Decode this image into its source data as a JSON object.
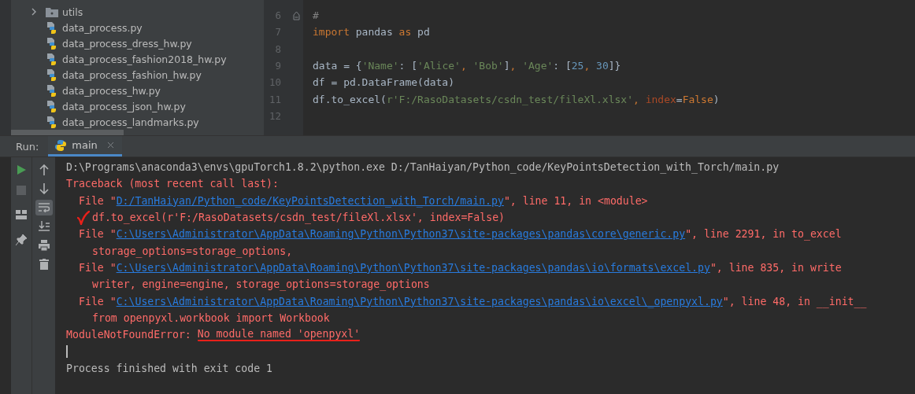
{
  "project_tree": {
    "items": [
      {
        "name": "utils",
        "kind": "folder",
        "expanded": false
      },
      {
        "name": "data_process.py",
        "kind": "python"
      },
      {
        "name": "data_process_dress_hw.py",
        "kind": "python"
      },
      {
        "name": "data_process_fashion2018_hw.py",
        "kind": "python"
      },
      {
        "name": "data_process_fashion_hw.py",
        "kind": "python"
      },
      {
        "name": "data_process_hw.py",
        "kind": "python"
      },
      {
        "name": "data_process_json_hw.py",
        "kind": "python"
      },
      {
        "name": "data_process_landmarks.py",
        "kind": "python"
      }
    ]
  },
  "editor": {
    "lines": [
      {
        "number": "6",
        "fold": true,
        "tokens": [
          {
            "kind": "comment",
            "text": "#"
          }
        ]
      },
      {
        "number": "7",
        "fold": false,
        "tokens": [
          {
            "kind": "kw",
            "text": "import"
          },
          {
            "kind": "plain",
            "text": " pandas "
          },
          {
            "kind": "kw",
            "text": "as"
          },
          {
            "kind": "plain",
            "text": " pd"
          }
        ]
      },
      {
        "number": "8",
        "fold": false
      },
      {
        "number": "9",
        "fold": false,
        "tokens": [
          {
            "kind": "plain",
            "text": "data = {"
          },
          {
            "kind": "str",
            "text": "'Name'"
          },
          {
            "kind": "plain",
            "text": ": ["
          },
          {
            "kind": "str",
            "text": "'Alice'"
          },
          {
            "kind": "kw",
            "text": ", "
          },
          {
            "kind": "str",
            "text": "'Bob'"
          },
          {
            "kind": "plain",
            "text": "]"
          },
          {
            "kind": "kw",
            "text": ", "
          },
          {
            "kind": "str",
            "text": "'Age'"
          },
          {
            "kind": "plain",
            "text": ": ["
          },
          {
            "kind": "num",
            "text": "25"
          },
          {
            "kind": "kw",
            "text": ", "
          },
          {
            "kind": "num",
            "text": "30"
          },
          {
            "kind": "plain",
            "text": "]}"
          }
        ]
      },
      {
        "number": "10",
        "fold": false,
        "tokens": [
          {
            "kind": "plain",
            "text": "df = pd.DataFrame(data)"
          }
        ]
      },
      {
        "number": "11",
        "fold": false,
        "tokens": [
          {
            "kind": "plain",
            "text": "df.to_excel("
          },
          {
            "kind": "str",
            "text": "r'F:/RasoDatasets/csdn_test/fileXl.xlsx'"
          },
          {
            "kind": "kw",
            "text": ", "
          },
          {
            "kind": "param",
            "text": "index"
          },
          {
            "kind": "plain",
            "text": "="
          },
          {
            "kind": "kw",
            "text": "False"
          },
          {
            "kind": "plain",
            "text": ")"
          }
        ]
      },
      {
        "number": "12",
        "fold": false
      }
    ]
  },
  "run_panel": {
    "label": "Run:",
    "tabs": [
      {
        "label": "main",
        "selected": true
      }
    ],
    "soft_wrap_on": true,
    "console": [
      {
        "kind": "cmd",
        "segments": [
          {
            "kind": "normal",
            "text": "D:\\Programs\\anaconda3\\envs\\gpuTorch1.8.2\\python.exe D:/TanHaiyan/Python_code/KeyPointsDetection_with_Torch/main.py"
          }
        ]
      },
      {
        "kind": "plain",
        "segments": [
          {
            "kind": "error",
            "text": "Traceback (most recent call last):"
          }
        ]
      },
      {
        "kind": "frame",
        "segments": [
          {
            "kind": "error",
            "text": "File \""
          },
          {
            "kind": "link",
            "text": "D:/TanHaiyan/Python_code/KeyPointsDetection_with_Torch/main.py"
          },
          {
            "kind": "error",
            "text": "\", line 11, in <module>"
          }
        ]
      },
      {
        "kind": "source",
        "ticked": true,
        "segments": [
          {
            "kind": "error",
            "text": "df.to_excel(r'F:/RasoDatasets/csdn_test/fileXl.xlsx', index=False)"
          }
        ]
      },
      {
        "kind": "frame",
        "segments": [
          {
            "kind": "error",
            "text": "File \""
          },
          {
            "kind": "link",
            "text": "C:\\Users\\Administrator\\AppData\\Roaming\\Python\\Python37\\site-packages\\pandas\\core\\generic.py"
          },
          {
            "kind": "error",
            "text": "\", line 2291, in to_excel"
          }
        ]
      },
      {
        "kind": "source",
        "segments": [
          {
            "kind": "error",
            "text": "storage_options=storage_options,"
          }
        ]
      },
      {
        "kind": "frame",
        "segments": [
          {
            "kind": "error",
            "text": "File \""
          },
          {
            "kind": "link",
            "text": "C:\\Users\\Administrator\\AppData\\Roaming\\Python\\Python37\\site-packages\\pandas\\io\\formats\\excel.py"
          },
          {
            "kind": "error",
            "text": "\", line 835, in write"
          }
        ]
      },
      {
        "kind": "source",
        "segments": [
          {
            "kind": "error",
            "text": "writer, engine=engine, storage_options=storage_options"
          }
        ]
      },
      {
        "kind": "frame",
        "segments": [
          {
            "kind": "error",
            "text": "File \""
          },
          {
            "kind": "link",
            "text": "C:\\Users\\Administrator\\AppData\\Roaming\\Python\\Python37\\site-packages\\pandas\\io\\excel\\_openpyxl.py"
          },
          {
            "kind": "error",
            "text": "\", line 48, in __init__"
          }
        ]
      },
      {
        "kind": "source",
        "segments": [
          {
            "kind": "error",
            "text": "from openpyxl.workbook import Workbook"
          }
        ]
      },
      {
        "kind": "plain",
        "segments": [
          {
            "kind": "error",
            "text": "ModuleNotFoundError: "
          },
          {
            "kind": "error",
            "text": "No module named 'openpyxl'",
            "marked": true
          }
        ]
      },
      {
        "kind": "caret"
      },
      {
        "kind": "plain",
        "segments": [
          {
            "kind": "normal",
            "text": "Process finished with exit code 1"
          }
        ]
      }
    ]
  }
}
